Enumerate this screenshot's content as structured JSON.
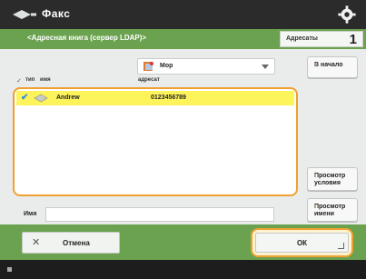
{
  "header": {
    "title": "Факс"
  },
  "address_bar": {
    "path": "<Адресная книга (сервер LDAP)>",
    "recipients_label": "Адресаты",
    "recipients_count": "1"
  },
  "filter": {
    "selected": "Мор"
  },
  "list": {
    "columns": {
      "check": "✓",
      "type": "тип",
      "name": "имя",
      "address": "адресат"
    },
    "rows": [
      {
        "checked": "✔",
        "name": "Andrew",
        "address": "0123456789"
      }
    ]
  },
  "side_buttons": {
    "details": "В начало",
    "prev": "Просмотр условия",
    "next": "Просмотр имени"
  },
  "name_field": {
    "label": "Имя",
    "value": ""
  },
  "footer": {
    "cancel": "Отмена",
    "ok": "ОК"
  },
  "colors": {
    "accent": "#6aa24f",
    "highlight": "#fdf35a",
    "focus": "#f0a030"
  }
}
